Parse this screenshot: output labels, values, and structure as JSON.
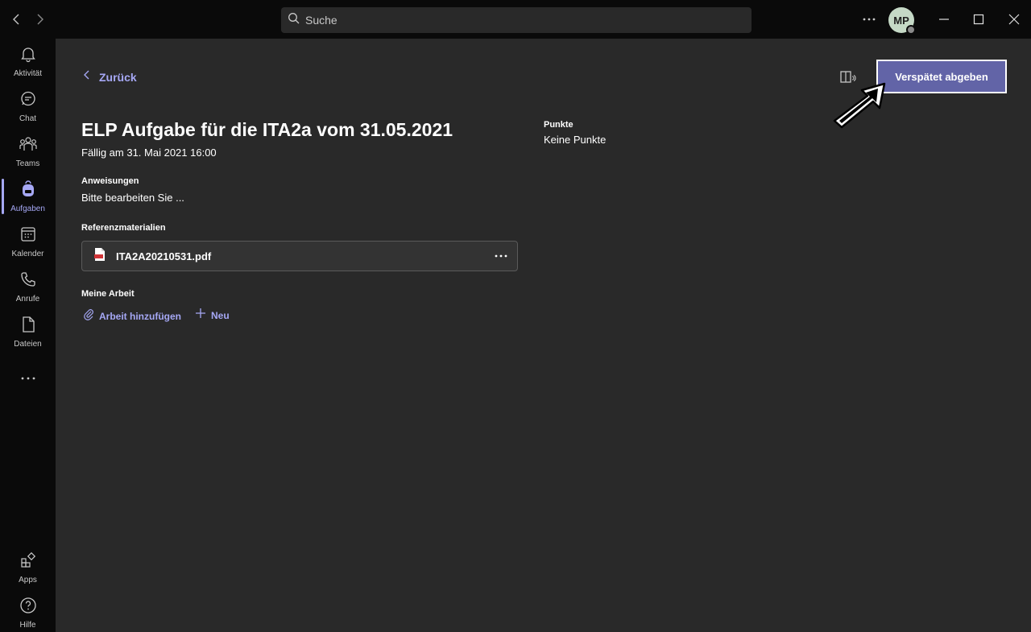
{
  "search": {
    "placeholder": "Suche"
  },
  "user": {
    "initials": "MP"
  },
  "rail": {
    "items": [
      {
        "label": "Aktivität",
        "icon": "bell-icon"
      },
      {
        "label": "Chat",
        "icon": "chat-icon"
      },
      {
        "label": "Teams",
        "icon": "teams-icon"
      },
      {
        "label": "Aufgaben",
        "icon": "backpack-icon",
        "active": true
      },
      {
        "label": "Kalender",
        "icon": "calendar-icon"
      },
      {
        "label": "Anrufe",
        "icon": "phone-icon"
      },
      {
        "label": "Dateien",
        "icon": "file-icon"
      }
    ],
    "apps_label": "Apps",
    "help_label": "Hilfe"
  },
  "assignment": {
    "back_label": "Zurück",
    "title": "ELP Aufgabe für die ITA2a vom 31.05.2021",
    "due": "Fällig am 31. Mai 2021 16:00",
    "instructions_label": "Anweisungen",
    "instructions_text": "Bitte bearbeiten Sie ...",
    "references_label": "Referenzmaterialien",
    "reference_file": "ITA2A20210531.pdf",
    "my_work_label": "Meine Arbeit",
    "add_work_label": "Arbeit hinzufügen",
    "new_label": "Neu",
    "points_label": "Punkte",
    "points_value": "Keine Punkte",
    "submit_label": "Verspätet abgeben"
  },
  "colors": {
    "accent": "#6264a7",
    "accent_light": "#a6a8f5",
    "background": "#292929",
    "rail": "#0a0a0a"
  }
}
